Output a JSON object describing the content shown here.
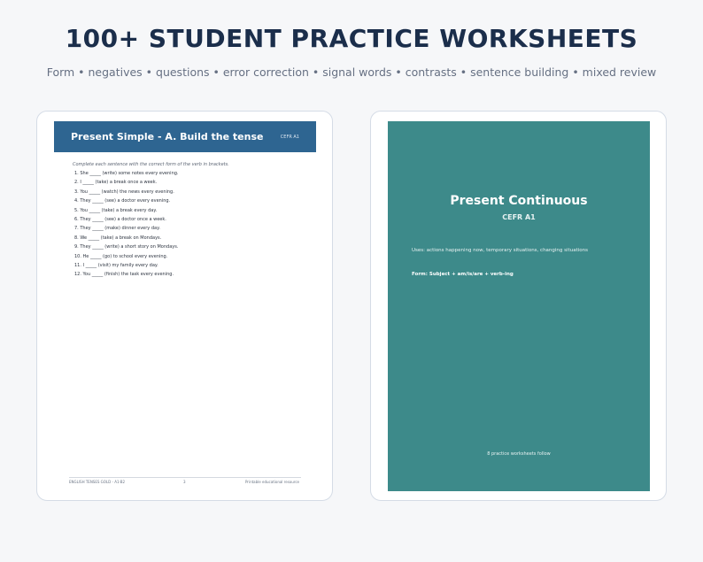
{
  "header": {
    "title": "100+ STUDENT PRACTICE WORKSHEETS",
    "subtitle": "Form • negatives • questions • error correction • signal words • contrasts • sentence building • mixed review"
  },
  "worksheet": {
    "title": "Present Simple - A. Build the tense",
    "level": "CEFR A1",
    "instructions": "Complete each sentence with the correct form of the verb in brackets.",
    "items": [
      "1. She _____ (write) some notes every evening.",
      "2. I _____ (take) a break once a week.",
      "3. You _____ (watch) the news every evening.",
      "4. They _____ (see) a doctor every evening.",
      "5. You _____ (take) a break every day.",
      "6. They _____ (see) a doctor once a week.",
      "7. They _____ (make) dinner every day.",
      "8. We _____ (take) a break on Mondays.",
      "9. They _____ (write) a short story on Mondays.",
      "10. He _____ (go) to school every evening.",
      "11. I _____ (visit) my family every day.",
      "12. You _____ (finish) the task every evening."
    ],
    "footer": {
      "left": "ENGLISH TENSES GOLD - A1-B2",
      "center": "3",
      "right": "Printable educational resource"
    }
  },
  "cover": {
    "title": "Present Continuous",
    "level": "CEFR A1",
    "uses": "Uses: actions happening now, temporary situations, changing situations",
    "form": "Form: Subject + am/is/are + verb-ing",
    "follow": "8 practice worksheets follow"
  },
  "colors": {
    "title": "#1b2e4b",
    "worksheet_header": "#2e6591",
    "cover_background": "#3d8a8a"
  }
}
